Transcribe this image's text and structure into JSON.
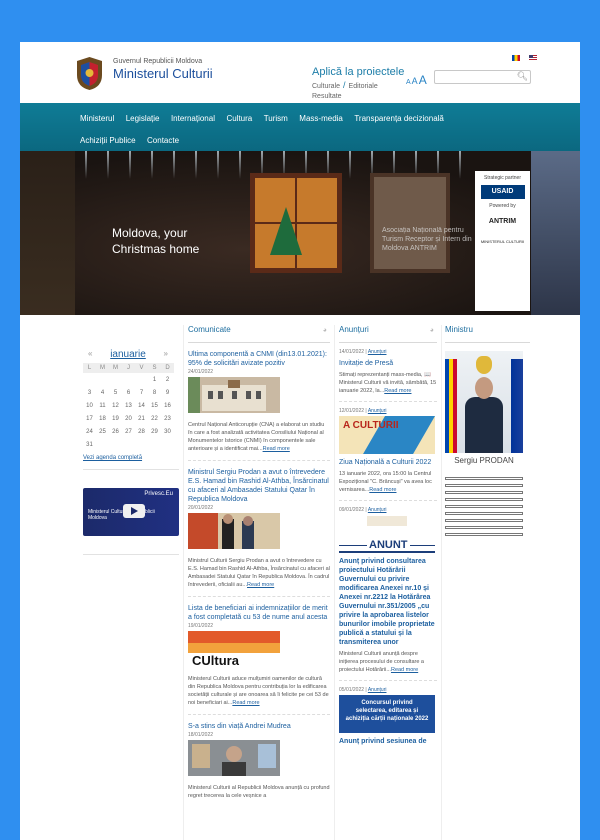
{
  "header": {
    "government": "Guvernul Republicii Moldova",
    "ministry": "Ministerul Culturii",
    "apply_title": "Aplică la proiectele",
    "apply_links": [
      "Culturale",
      "Editoriale",
      "Resultate"
    ],
    "font_size_labels": [
      "A",
      "A",
      "A"
    ],
    "search_placeholder": ""
  },
  "nav": {
    "items": [
      "Ministerul",
      "Legislație",
      "Internațional",
      "Cultura",
      "Turism",
      "Mass-media",
      "Transparența decizională",
      "Achiziții Publice",
      "Contacte"
    ]
  },
  "banner": {
    "headline_line1": "Moldova, your",
    "headline_line2": "Christmas home",
    "caption": "Asociația Națională pentru Turism Receptor și Intern din Moldova ANTRIM",
    "strategic_partner": "Strategic partner",
    "usaid": "USAID",
    "powered_by": "Powered by",
    "antrim": "ANTRIM",
    "ministry_small": "MINISTERUL CULTURII"
  },
  "calendar": {
    "month": "ianuarie",
    "prev": "«",
    "next": "»",
    "weekdays": [
      "L",
      "M",
      "M",
      "J",
      "V",
      "S",
      "D"
    ],
    "weeks": [
      [
        "",
        "",
        "",
        "",
        "",
        "1",
        "2"
      ],
      [
        "3",
        "4",
        "5",
        "6",
        "7",
        "8",
        "9"
      ],
      [
        "10",
        "11",
        "12",
        "13",
        "14",
        "15",
        "16"
      ],
      [
        "17",
        "18",
        "19",
        "20",
        "21",
        "22",
        "23"
      ],
      [
        "24",
        "25",
        "26",
        "27",
        "28",
        "29",
        "30"
      ],
      [
        "31",
        "",
        "",
        "",
        "",
        "",
        ""
      ]
    ],
    "agenda_link": "Vezi agenda completă"
  },
  "video": {
    "brand": "Privesc.Eu",
    "title": "Ministerul Culturii al Republicii Moldova"
  },
  "news": {
    "heading": "Comunicate",
    "items": [
      {
        "title": "Ultima componentă a CNMI (din13.01.2021): 95% de solicitări avizate pozitiv",
        "date": "24/01/2022",
        "body": "Centrul Național Anticorupție (CNA) a elaborat un studiu în care a fost analizată activitatea Consiliului Național al Monumentelor Istorice (CNMI) în componentele sale anterioare și a identificat mai...",
        "more": "Read more"
      },
      {
        "title": "Ministrul Sergiu Prodan a avut o întrevedere E.S. Hamad bin Rashid Al-Athba, Însărcinatul cu afaceri al Ambasadei Statului Qatar în Republica Moldova",
        "date": "20/01/2022",
        "body": "Ministrul Culturii Sergiu Prodan a avut o întrevedere cu E.S. Hamad bin Rashid Al-Athba, Însărcinatul cu afaceri al Ambasadei Statului Qatar în Republica Moldova. În cadrul întrevederii, oficialii au...",
        "more": "Read more"
      },
      {
        "title": "Lista de beneficiari ai indemnizațiilor de merit a fost completată cu 53 de nume anul acesta",
        "date": "19/01/2022",
        "body": "Ministerul Culturii aduce mulțumiri oamenilor de cultură din Republica Moldova pentru contribuția lor la edificarea societății culturale și are onoarea să îi felicite pe cei 53 de noi beneficiari ai...",
        "more": "Read more"
      },
      {
        "title": "S-a stins din viață Andrei Mudrea",
        "date": "18/01/2022",
        "body": "Ministerul Culturii al Republicii Moldova anunță cu profund regret trecerea la cele veșnice a",
        "more": ""
      }
    ]
  },
  "announcements": {
    "heading": "Anunțuri",
    "items": [
      {
        "date": "14/01/2022",
        "category": "Anunțuri",
        "title": "Invitație de Presă",
        "body": "Stimați reprezentanți mass-media, 📖 Ministerul Culturii vă invită, sâmbătă, 15 ianuarie 2022, la...",
        "more": "Read more"
      },
      {
        "date": "12/01/2022",
        "category": "Anunțuri",
        "image_text": "A CULTURII",
        "title": "Ziua Națională a Culturii 2022",
        "body": "13 ianuarie 2022, ora 15:00 la Centrul Expozițional \"C. Brâncuși\" va avea loc vernisarea...",
        "more": "Read more"
      },
      {
        "date": "09/01/2022",
        "category": "Anunțuri",
        "image_text": "ANUNT",
        "title": "Anunț privind consultarea proiectului Hotărârii Guvernului cu privire modificarea Anexei nr.10 și Anexei nr.2212 la Hotărârea Guvernului nr.351/2005 „cu privire la aprobarea listelor bunurilor imobile proprietate publică a statului și la transmiterea unor",
        "body": "Ministerul Culturii anunță despre inițierea procesului de consultare a proiectului Hotărârii...",
        "more": "Read more"
      },
      {
        "date": "05/01/2022",
        "category": "Anunțuri",
        "image_text": "Concursul privind selectarea, editarea și achiziția cărții naționale 2022",
        "title": "Anunț privind sesiunea de",
        "body": "",
        "more": ""
      }
    ]
  },
  "minister": {
    "heading": "Ministru",
    "name": "Sergiu PRODAN"
  }
}
